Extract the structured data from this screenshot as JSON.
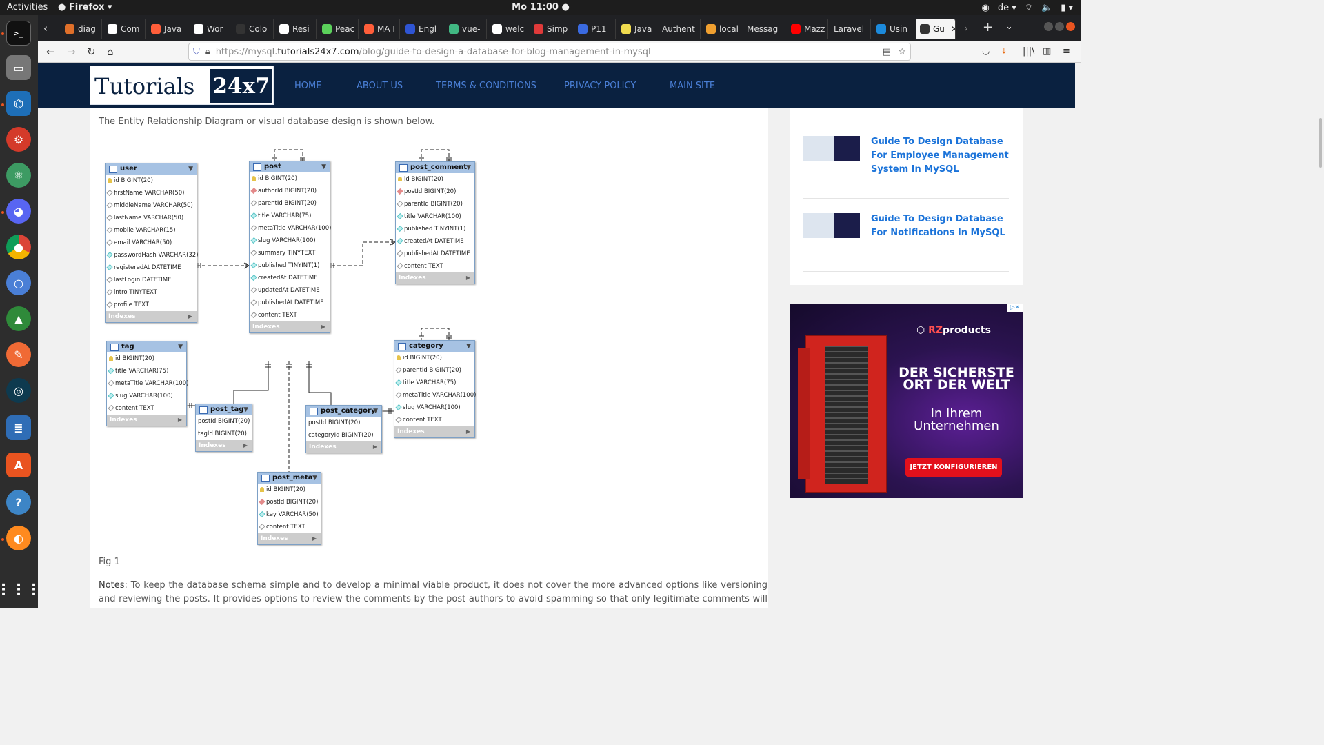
{
  "system": {
    "activities": "Activities",
    "app_name": "Firefox",
    "clock": "Mo 11:00",
    "lang": "de"
  },
  "tabs": [
    {
      "label": "diag",
      "color": "#e0702a"
    },
    {
      "label": "Com",
      "color": "#ffffff"
    },
    {
      "label": "Java",
      "color": "#ff5e3a"
    },
    {
      "label": "Wor",
      "color": "#ffffff"
    },
    {
      "label": "Colo",
      "color": "#333333"
    },
    {
      "label": "Resi",
      "color": "#ffffff"
    },
    {
      "label": "Peac",
      "color": "#5bd15b"
    },
    {
      "label": "MA I",
      "color": "#ff5e3a"
    },
    {
      "label": "Engl",
      "color": "#2f55d4"
    },
    {
      "label": "vue-",
      "color": "#41b883"
    },
    {
      "label": "welc",
      "color": "#ffffff"
    },
    {
      "label": "Simp",
      "color": "#e03a3a"
    },
    {
      "label": "P11",
      "color": "#3a6ae0"
    },
    {
      "label": "Java",
      "color": "#f0db4f"
    },
    {
      "label": "Authent",
      "color": ""
    },
    {
      "label": "local",
      "color": "#f0a030"
    },
    {
      "label": "Messag",
      "color": ""
    },
    {
      "label": "Mazz",
      "color": "#ff0000"
    },
    {
      "label": "Laravel",
      "color": ""
    },
    {
      "label": "Usin",
      "color": "#1c8adb"
    },
    {
      "label": "Gu",
      "color": "#333333"
    }
  ],
  "nav": {
    "url_prefix": "https://mysql.",
    "url_domain": "tutorials24x7.com",
    "url_path": "/blog/guide-to-design-a-database-for-blog-management-in-mysql"
  },
  "site": {
    "logo_text": "Tutorials",
    "logo_box": "24x7",
    "menu": [
      "HOME",
      "ABOUT US",
      "TERMS & CONDITIONS",
      "PRIVACY POLICY",
      "MAIN SITE"
    ]
  },
  "article": {
    "intro": "The Entity Relationship Diagram or visual database design is shown below.",
    "fig": "Fig 1",
    "notes_label": "Notes",
    "notes_text": ": To keep the database schema simple and to develop a minimal viable product, it does not cover the more advanced options like versioning and reviewing the posts. It provides options to review the comments by the post authors to avoid spamming so that only legitimate comments will be"
  },
  "erd": {
    "indexes_label": "Indexes",
    "entities": [
      {
        "name": "user",
        "columns": [
          {
            "k": "pk",
            "t": "id BIGINT(20)"
          },
          {
            "k": "op",
            "t": "firstName VARCHAR(50)"
          },
          {
            "k": "op",
            "t": "middleName VARCHAR(50)"
          },
          {
            "k": "op",
            "t": "lastName VARCHAR(50)"
          },
          {
            "k": "op",
            "t": "mobile VARCHAR(15)"
          },
          {
            "k": "op",
            "t": "email VARCHAR(50)"
          },
          {
            "k": "nn",
            "t": "passwordHash VARCHAR(32)"
          },
          {
            "k": "nn",
            "t": "registeredAt DATETIME"
          },
          {
            "k": "op",
            "t": "lastLogin DATETIME"
          },
          {
            "k": "op",
            "t": "intro TINYTEXT"
          },
          {
            "k": "op",
            "t": "profile TEXT"
          }
        ]
      },
      {
        "name": "post",
        "columns": [
          {
            "k": "pk",
            "t": "id BIGINT(20)"
          },
          {
            "k": "fk",
            "t": "authorId BIGINT(20)"
          },
          {
            "k": "op",
            "t": "parentId BIGINT(20)"
          },
          {
            "k": "nn",
            "t": "title VARCHAR(75)"
          },
          {
            "k": "op",
            "t": "metaTitle VARCHAR(100)"
          },
          {
            "k": "nn",
            "t": "slug VARCHAR(100)"
          },
          {
            "k": "op",
            "t": "summary TINYTEXT"
          },
          {
            "k": "nn",
            "t": "published TINYINT(1)"
          },
          {
            "k": "nn",
            "t": "createdAt DATETIME"
          },
          {
            "k": "op",
            "t": "updatedAt DATETIME"
          },
          {
            "k": "op",
            "t": "publishedAt DATETIME"
          },
          {
            "k": "op",
            "t": "content TEXT"
          }
        ]
      },
      {
        "name": "post_comment",
        "columns": [
          {
            "k": "pk",
            "t": "id BIGINT(20)"
          },
          {
            "k": "fk",
            "t": "postId BIGINT(20)"
          },
          {
            "k": "op",
            "t": "parentId BIGINT(20)"
          },
          {
            "k": "nn",
            "t": "title VARCHAR(100)"
          },
          {
            "k": "nn",
            "t": "published TINYINT(1)"
          },
          {
            "k": "nn",
            "t": "createdAt DATETIME"
          },
          {
            "k": "op",
            "t": "publishedAt DATETIME"
          },
          {
            "k": "op",
            "t": "content TEXT"
          }
        ]
      },
      {
        "name": "tag",
        "columns": [
          {
            "k": "pk",
            "t": "id BIGINT(20)"
          },
          {
            "k": "nn",
            "t": "title VARCHAR(75)"
          },
          {
            "k": "op",
            "t": "metaTitle VARCHAR(100)"
          },
          {
            "k": "nn",
            "t": "slug VARCHAR(100)"
          },
          {
            "k": "op",
            "t": "content TEXT"
          }
        ]
      },
      {
        "name": "post_tag",
        "columns": [
          {
            "k": "",
            "t": "postId BIGINT(20)"
          },
          {
            "k": "",
            "t": "tagId BIGINT(20)"
          }
        ]
      },
      {
        "name": "post_category",
        "columns": [
          {
            "k": "",
            "t": "postId BIGINT(20)"
          },
          {
            "k": "",
            "t": "categoryId BIGINT(20)"
          }
        ]
      },
      {
        "name": "category",
        "columns": [
          {
            "k": "pk",
            "t": "id BIGINT(20)"
          },
          {
            "k": "op",
            "t": "parentId BIGINT(20)"
          },
          {
            "k": "nn",
            "t": "title VARCHAR(75)"
          },
          {
            "k": "op",
            "t": "metaTitle VARCHAR(100)"
          },
          {
            "k": "nn",
            "t": "slug VARCHAR(100)"
          },
          {
            "k": "op",
            "t": "content TEXT"
          }
        ]
      },
      {
        "name": "post_meta",
        "columns": [
          {
            "k": "pk",
            "t": "id BIGINT(20)"
          },
          {
            "k": "fk",
            "t": "postId BIGINT(20)"
          },
          {
            "k": "nn",
            "t": "key VARCHAR(50)"
          },
          {
            "k": "op",
            "t": "content TEXT"
          }
        ]
      }
    ]
  },
  "sidebar": {
    "related": [
      {
        "title": "Guide To Design Database For Employee Management System In MySQL"
      },
      {
        "title": "Guide To Design Database For Notifications In MySQL"
      }
    ]
  },
  "ad": {
    "close": "▷✕",
    "brand_prefix": "RZ",
    "brand_suffix": "products",
    "headline": "DER SICHERSTE ORT DER WELT",
    "subline": "In Ihrem Unternehmen",
    "cta": "JETZT KONFIGURIEREN"
  }
}
